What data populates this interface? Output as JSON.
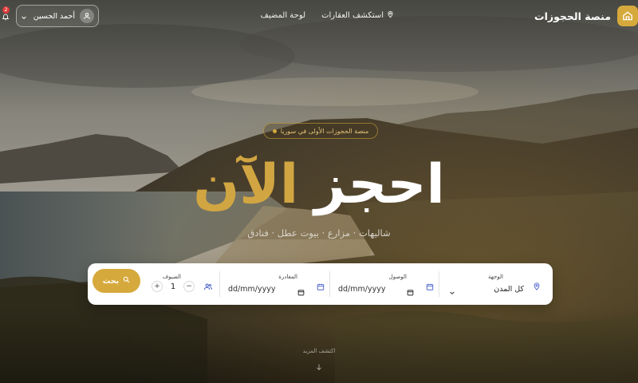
{
  "header": {
    "brand_name": "منصة الحجوزات",
    "nav": [
      {
        "label": "استكشف العقارات",
        "icon": "map-pin-icon"
      },
      {
        "label": "لوحة المضيف"
      }
    ],
    "user_name": "أحمد الحسين",
    "notification_count": "2"
  },
  "hero": {
    "tag": "منصة الحجوزات الأولى في سوريا",
    "title_main": "احجز",
    "title_accent": "الآن",
    "subtitle": "شاليهات · مزارع · بيوت عطل · فنادق"
  },
  "search": {
    "destination_label": "الوجهة",
    "destination_value": "كل المدن",
    "checkin_label": "الوصول",
    "checkin_placeholder": "dd/mm/yyyy",
    "checkout_label": "المغادرة",
    "checkout_placeholder": "dd/mm/yyyy",
    "guests_label": "الضيوف",
    "guests_value": "1",
    "search_label": "بحث"
  },
  "explore_more": "اكتشف المزيد",
  "colors": {
    "accent": "#d6a93c",
    "text_light": "#ffffff"
  }
}
